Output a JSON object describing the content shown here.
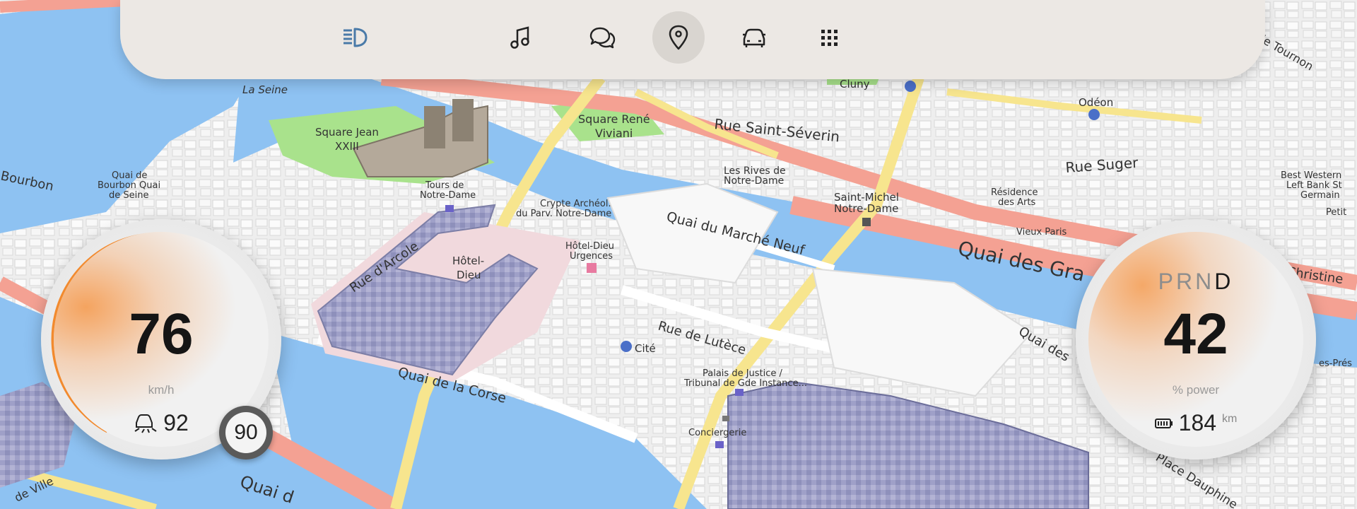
{
  "map": {
    "labels": {
      "la_seine": "La Seine",
      "square_jean": "Square Jean",
      "xxiii": "XXIII",
      "square_rene": "Square René",
      "viviani": "Viviani",
      "cluny": "Cluny",
      "odeon": "Odéon",
      "rue_saint_severin": "Rue  Saint-Séverin",
      "rue_suger": "Rue  Suger",
      "les_rives": "Les Rives de",
      "notre_dame_2": "Notre-Dame",
      "saint_michel": "Saint-Michel",
      "notre_dame_3": "Notre-Dame",
      "residence": "Résidence",
      "des_arts": "des Arts",
      "best_western": "Best Western",
      "left_bank": "Left Bank St",
      "germain": "Germain",
      "petit": "Petit",
      "vieux_paris": "Vieux Paris",
      "quai_des_gr": "Quai  des  Gra",
      "christine": "Christine",
      "quai_des_2": "Quai  des",
      "tours_de": "Tours de",
      "notre_dame_1": "Notre-Dame",
      "crypte": "Crypte Archéol.",
      "du_parv": "du Parv. Notre-Dame",
      "quai_du_marche": "Quai  du  Marché  Neuf",
      "rue_darcole": "Rue  d'Arcole",
      "hotel_dieu": "Hôtel-",
      "dieu": "Dieu",
      "hotel_dieu_urg": "Hôtel-Dieu",
      "urgences": "Urgences",
      "rue_de_lutece": "Rue  de  Lutèce",
      "cite": "Cité",
      "palais": "Palais de Justice /",
      "tribunal": "Tribunal de Gde Instance...",
      "conciergerie": "Conciergerie",
      "quai_de_la_corse": "Quai  de  la  Corse",
      "bourbon": "Bourbon",
      "quai_de_bourbon": "Quai de",
      "bourbon_quai": "Bourbon Quai",
      "de_seine": "de Seine",
      "de_ville": "de  Ville",
      "quai_d": "Quai  d",
      "place_dauphine": "Place  Dauphine",
      "rue_de_tournon": "rue  de  Tournon",
      "es_pres": "es-Prés"
    }
  },
  "topbar": {
    "icons": [
      "headlights-icon",
      "music-icon",
      "messages-icon",
      "navigation-icon",
      "car-icon",
      "apps-icon"
    ],
    "active": "navigation-icon"
  },
  "speed_gauge": {
    "value": "76",
    "unit": "km/h",
    "cruise_value": "92",
    "limit": "90",
    "accent": "#f28a2e"
  },
  "power_gauge": {
    "gear_options": [
      "P",
      "R",
      "N",
      "D"
    ],
    "gear_selected": "D",
    "value": "42",
    "unit": "% power",
    "range_value": "184",
    "range_unit": "km",
    "accent": "#f28a2e"
  },
  "colors": {
    "water": "#8ec2f2",
    "road_major": "#f4a193",
    "road_yellow": "#f7e58e",
    "park": "#a9e28c",
    "building": "#f3f3f3",
    "hotel_dieu": "#a8a8cc"
  }
}
